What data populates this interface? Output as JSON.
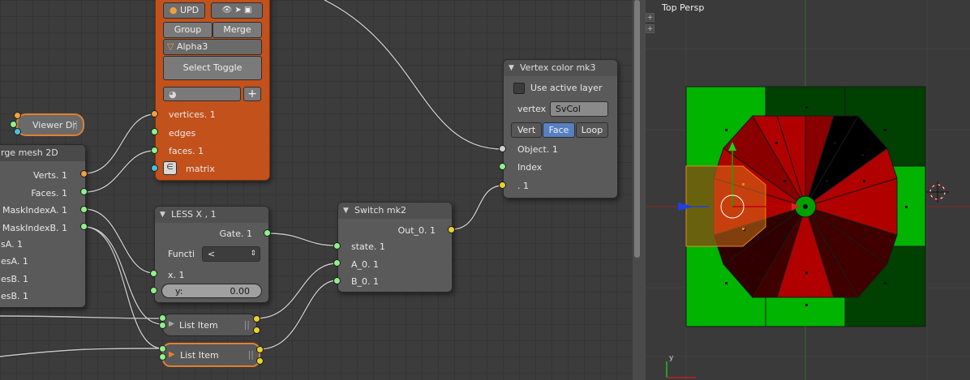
{
  "node_editor": {
    "top_node": {
      "upd_label": "UPD",
      "group_label": "Group",
      "merge_label": "Merge",
      "object_name": "Alpha3",
      "select_toggle_label": "Select Toggle",
      "outputs": [
        "vertices. 1",
        "edges",
        "faces. 1",
        "matrix"
      ]
    },
    "viewer_node": {
      "title": "Viewer Dr"
    },
    "merge_node": {
      "title": "rge mesh 2D",
      "outputs": [
        "Verts. 1",
        "Faces. 1",
        "MaskIndexA. 1",
        "MaskIndexB. 1"
      ],
      "inputs": [
        "sA. 1",
        "esA. 1",
        "esB. 1",
        "esB. 1"
      ]
    },
    "less_node": {
      "title": "LESS X ,  1",
      "gate_label": "Gate. 1",
      "function_label": "Functi",
      "function_value": "<",
      "x_label": "x. 1",
      "y_label": "y:",
      "y_value": "0.00"
    },
    "switch_node": {
      "title": "Switch mk2",
      "output": "Out_0. 1",
      "inputs": [
        "state. 1",
        "A_0. 1",
        "B_0. 1"
      ]
    },
    "vertex_color_node": {
      "title": "Vertex color mk3",
      "checkbox_label": "Use active layer",
      "vertex_label": "vertex",
      "vertex_value": "SvCol",
      "modes": [
        "Vert",
        "Face",
        "Loop"
      ],
      "active_mode": "Face",
      "inputs": [
        "Object. 1",
        "Index",
        ". 1"
      ]
    },
    "list_item_1": {
      "title": "List Item"
    },
    "list_item_2": {
      "title": "List Item"
    }
  },
  "viewport": {
    "title": "Top Persp",
    "axis_y_label": "y"
  },
  "colors": {
    "node_orange": "#c3511c",
    "socket_green": "#8ef08a",
    "socket_yellow": "#e8d22c",
    "bright_green": "#00b400",
    "dark_green": "#004000",
    "red": "#b00000",
    "selected_blue": "#5680c2"
  }
}
